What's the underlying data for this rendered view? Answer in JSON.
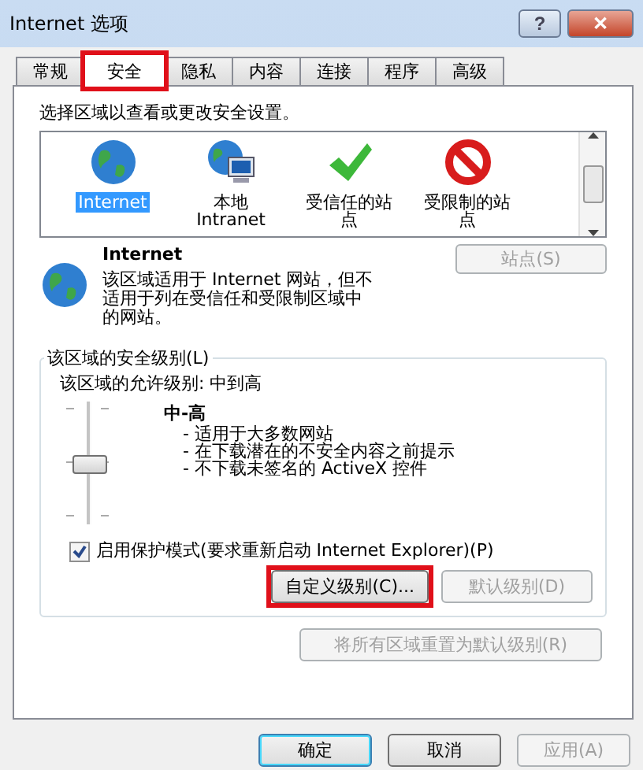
{
  "window": {
    "title": "Internet 选项",
    "buttons": [
      "?",
      "✕"
    ]
  },
  "tabs": [
    {
      "label": "常规",
      "selected": false,
      "highlighted": false
    },
    {
      "label": "安全",
      "selected": true,
      "highlighted": true
    },
    {
      "label": "隐私",
      "selected": false,
      "highlighted": false
    },
    {
      "label": "内容",
      "selected": false,
      "highlighted": false
    },
    {
      "label": "连接",
      "selected": false,
      "highlighted": false
    },
    {
      "label": "程序",
      "selected": false,
      "highlighted": false
    },
    {
      "label": "高级",
      "selected": false,
      "highlighted": false
    }
  ],
  "zone_prompt": "选择区域以查看或更改安全设置。",
  "zones": [
    {
      "kind": "globe",
      "label": "Internet",
      "selected": true
    },
    {
      "kind": "intranet",
      "label": "本地\nIntranet",
      "selected": false
    },
    {
      "kind": "trusted",
      "label": "受信任的站点",
      "selected": false
    },
    {
      "kind": "restricted",
      "label": "受限制的站点",
      "selected": false
    }
  ],
  "zone_info": {
    "title": "Internet",
    "description": "该区域适用于 Internet 网站，但不适用于列在受信任和受限制区域中的网站。",
    "sites_button": {
      "label": "站点(S)",
      "disabled": true
    }
  },
  "security_level": {
    "group_label": "该区域的安全级别(L)",
    "allowed": "该区域的允许级别: 中到高",
    "level": 0.5,
    "level_name": "中-高",
    "bullets": [
      "- 适用于大多数网站",
      "- 在下载潜在的不安全内容之前提示",
      "- 不下载未签名的 ActiveX 控件"
    ],
    "protected_mode": {
      "label": "启用保护模式(要求重新启动 Internet Explorer)(P)",
      "checked": true
    },
    "buttons": [
      {
        "label": "自定义级别(C)...",
        "disabled": false,
        "highlighted": true
      },
      {
        "label": "默认级别(D)",
        "disabled": true,
        "highlighted": false
      }
    ]
  },
  "reset_button": {
    "label": "将所有区域重置为默认级别(R)",
    "disabled": true
  },
  "footer_buttons": [
    {
      "label": "确定",
      "disabled": false,
      "default": true
    },
    {
      "label": "取消",
      "disabled": false,
      "default": false
    },
    {
      "label": "应用(A)",
      "disabled": true,
      "default": false
    }
  ]
}
